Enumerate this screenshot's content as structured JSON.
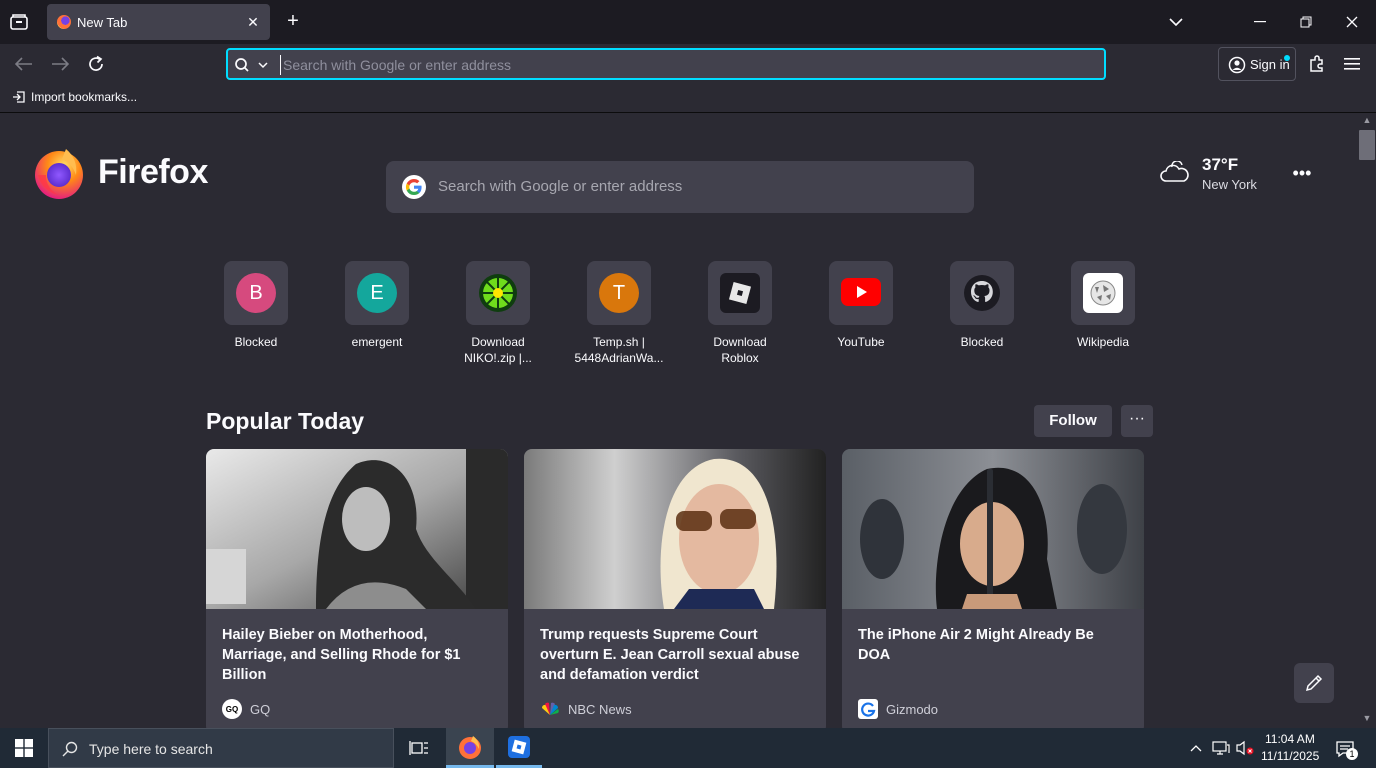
{
  "tab": {
    "title": "New Tab"
  },
  "urlbar": {
    "placeholder": "Search with Google or enter address"
  },
  "signin": {
    "label": "Sign in"
  },
  "bookmarks": {
    "import_label": "Import bookmarks..."
  },
  "brand": {
    "wordmark": "Firefox"
  },
  "hero_search": {
    "placeholder": "Search with Google or enter address"
  },
  "weather": {
    "temp": "37°F",
    "city": "New York",
    "icon": "cloud-icon"
  },
  "topsites": [
    {
      "label": "Blocked",
      "letter": "B",
      "color": "#d64a7e"
    },
    {
      "label": "emergent",
      "letter": "E",
      "color": "#14a79c"
    },
    {
      "label": "Download\nNIKO!.zip |...",
      "letter": "",
      "color": "#2b2a33"
    },
    {
      "label": "Temp.sh |\n5448AdrianWa...",
      "letter": "T",
      "color": "#d9770c"
    },
    {
      "label": "Download\nRoblox",
      "letter": "",
      "color": "#2b2a33"
    },
    {
      "label": "YouTube",
      "letter": "",
      "color": "#ff0000"
    },
    {
      "label": "Blocked",
      "letter": "",
      "color": "#2b2a33"
    },
    {
      "label": "Wikipedia",
      "letter": "",
      "color": "#ffffff"
    }
  ],
  "popular": {
    "title": "Popular Today",
    "follow_label": "Follow",
    "more_label": "···",
    "cards": [
      {
        "title": "Hailey Bieber on Motherhood, Marriage, and Selling Rhode for $1 Billion",
        "source": "GQ"
      },
      {
        "title": "Trump requests Supreme Court overturn E. Jean Carroll sexual abuse and defamation verdict",
        "source": "NBC News"
      },
      {
        "title": "The iPhone Air 2 Might Already Be DOA",
        "source": "Gizmodo"
      }
    ]
  },
  "taskbar": {
    "search_placeholder": "Type here to search",
    "time": "11:04 AM",
    "date": "11/11/2025",
    "notif_count": "1"
  },
  "colors": {
    "accent": "#00ddff",
    "surface": "#42414d",
    "background": "#2b2a33"
  }
}
